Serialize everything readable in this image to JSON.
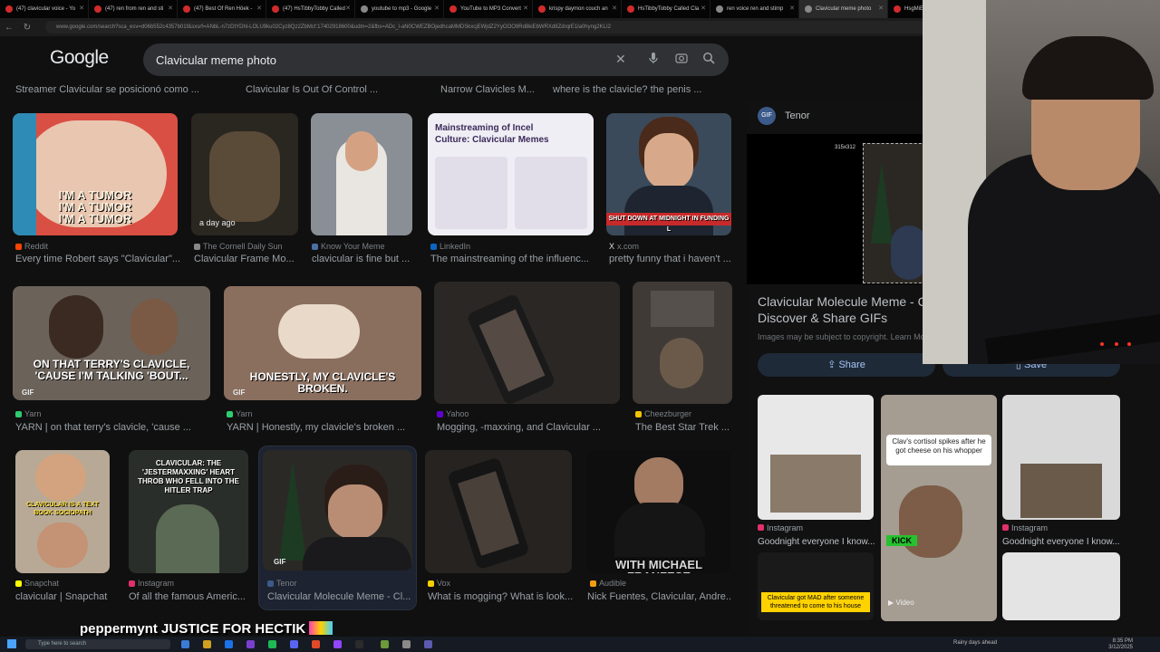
{
  "browser": {
    "tabs": [
      {
        "label": "(47) clavicular voice - Yo",
        "fav": "yt"
      },
      {
        "label": "(47) ren from ren and sti",
        "fav": "yt"
      },
      {
        "label": "(47) Best Of Ren Höek -",
        "fav": "yt"
      },
      {
        "label": "(47) HsTibbyTobby Called",
        "fav": "yt"
      },
      {
        "label": "youtube to mp3 - Google",
        "fav": "g"
      },
      {
        "label": "YouTube to MP3 Convert",
        "fav": "yt"
      },
      {
        "label": "krispy daymon couch an",
        "fav": "yt"
      },
      {
        "label": "HsTibbyTobby Called Cla",
        "fav": "yt"
      },
      {
        "label": "ren voice ren and stimp",
        "fav": "g"
      },
      {
        "label": "Clavicular meme photo",
        "fav": "g"
      },
      {
        "label": "HsgMiE",
        "fav": "yt"
      }
    ],
    "url": "www.google.com/search?sca_esv=d06b552c4357b01f&sxsrf=ANbL-n7zDtYDhl-LOLU9ku02Cyz8Qz2ZbMcf:17402918600&udm=2&fbs=ADc_l-aN0CWEZBOjedhcaMMDSkxcjEWjdZ2YyOOO9Rd8kiEbWRXd8ZdrqrE1la0hyng2KLI2"
  },
  "search": {
    "logo": "Google",
    "query": "Clavicular meme photo"
  },
  "related_chips": [
    "Streamer Clavicular se posicionó como ...",
    "Clavicular Is Out Of Control ...",
    "Narrow Clavicles M...",
    "where is the clavicle? the penis ..."
  ],
  "results": [
    {
      "source": "Reddit",
      "title": "Every time Robert says \"Clavicular\"...",
      "caption": "I'M A TUMOR\nI'M A TUMOR\nI'M A TUMOR",
      "badge": "",
      "color": "#ff4500"
    },
    {
      "source": "The Cornell Daily Sun",
      "title": "Clavicular Frame Mo...",
      "caption": "",
      "badge": "a day ago",
      "color": "#888888"
    },
    {
      "source": "Know Your Meme",
      "title": "clavicular is fine but ...",
      "caption": "",
      "badge": "",
      "color": "#4a6fa5"
    },
    {
      "source": "LinkedIn",
      "title": "The mainstreaming of the influenc...",
      "caption": "Mainstreaming of Incel Culture: Clavicular Memes",
      "badge": "",
      "color": "#0a66c2"
    },
    {
      "source": "x.com",
      "title": "pretty funny that i haven't ...",
      "caption": "SHUT DOWN AT MIDNIGHT IN FUNDING L",
      "badge": "",
      "color": "#dddddd"
    },
    {
      "source": "Yarn",
      "title": "YARN | on that terry's clavicle, 'cause ...",
      "caption": "ON THAT TERRY'S CLAVICLE, 'CAUSE I'M TALKING 'BOUT...",
      "badge": "GIF",
      "color": "#2ecc71"
    },
    {
      "source": "Yarn",
      "title": "YARN | Honestly, my clavicle's broken ...",
      "caption": "HONESTLY, MY CLAVICLE'S BROKEN.",
      "badge": "GIF",
      "color": "#2ecc71"
    },
    {
      "source": "Yahoo",
      "title": "Mogging, -maxxing, and Clavicular ...",
      "caption": "",
      "badge": "",
      "color": "#6001d2"
    },
    {
      "source": "Cheezburger",
      "title": "The Best Star Trek ...",
      "caption": "",
      "badge": "",
      "color": "#f2c300"
    },
    {
      "source": "Snapchat",
      "title": "clavicular | Snapchat",
      "caption": "CLAVICULAR IS A TEXT BOOK SOCIOPATH",
      "badge": "",
      "color": "#fffc00"
    },
    {
      "source": "Instagram",
      "title": "Of all the famous Americ...",
      "caption": "CLAVICULAR: THE 'JESTERMAXXING' HEART THROB WHO FELL INTO THE HITLER TRAP",
      "badge": "",
      "color": "#e1306c"
    },
    {
      "source": "Tenor",
      "title": "Clavicular Molecule Meme - Cl...",
      "caption": "",
      "badge": "GIF",
      "color": "#3c5a8a"
    },
    {
      "source": "Vox",
      "title": "What is mogging? What is look...",
      "caption": "",
      "badge": "",
      "color": "#f5d000"
    },
    {
      "source": "Audible",
      "title": "Nick Fuentes, Clavicular, Andre...",
      "caption": "WITH MICHAEL FRANZESE",
      "badge": "",
      "color": "#f39c12"
    }
  ],
  "panel": {
    "source": "Tenor",
    "logo_text": "GIF",
    "dims": "315x312",
    "title": "Clavicular Molecule Meme - C Discover & Share GIFs",
    "note": "Images may be subject to copyright. Learn Mo",
    "share_label": "Share",
    "save_label": "Save",
    "related": [
      {
        "source": "Instagram",
        "title": "Goodnight everyone I know..."
      },
      {
        "source": "Instagram",
        "title": "Goodnight everyone I know..."
      },
      {
        "caption": "Clav's cortisol spikes after he got cheese on his whopper"
      },
      {
        "caption": "Clavicular got MAD after someone threatened to come to his house"
      },
      {
        "badge": "Video"
      }
    ]
  },
  "stream_overlay": "peppermynt  JUSTICE FOR HECTIK",
  "taskbar": {
    "search_placeholder": "Type here to search",
    "time": "8:35 PM",
    "date": "3/12/2025",
    "weather": "Rainy days ahead"
  }
}
